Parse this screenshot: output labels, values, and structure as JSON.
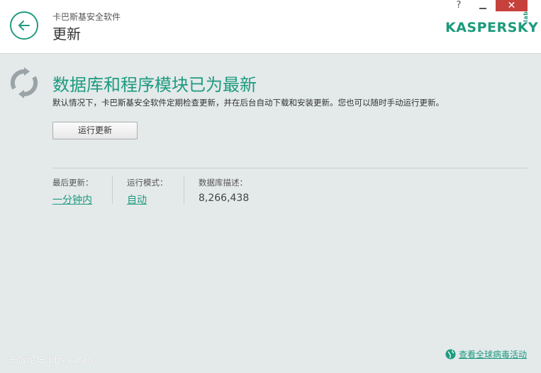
{
  "header": {
    "app_name": "卡巴斯基安全软件",
    "section_title": "更新",
    "logo_text": "KASPERSKY",
    "logo_suffix": "lab",
    "help_label": "?",
    "close_label": "✕"
  },
  "status": {
    "title": "数据库和程序模块已为最新",
    "description": "默认情况下，卡巴斯基安全软件定期检查更新，并在后台自动下载和安装更新。您也可以随时手动运行更新。"
  },
  "actions": {
    "run_update_label": "运行更新"
  },
  "info": [
    {
      "label": "最后更新：",
      "value": "一分钟内"
    },
    {
      "label": "运行模式：",
      "value": "自动"
    },
    {
      "label": "数据库描述：",
      "value": "8,266,438"
    }
  ],
  "footer": {
    "watermark": "卡饭论坛 bbs.kafan.cn",
    "global_activity_link": "查看全球病毒活动"
  },
  "colors": {
    "accent": "#1d9b80",
    "close_button": "#c7413c",
    "background": "#e4e9ea"
  }
}
